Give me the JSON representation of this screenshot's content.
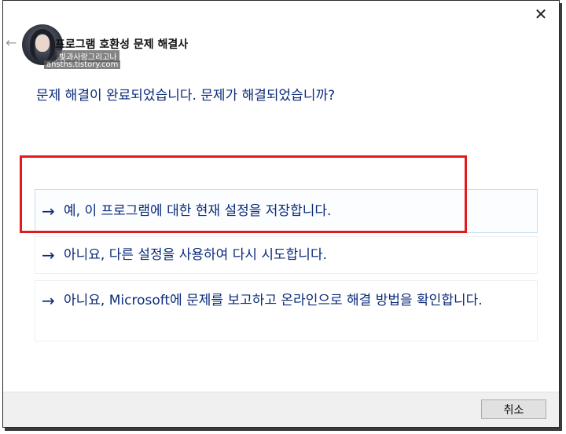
{
  "window": {
    "title": "프로그램 호환성 문제 해결사",
    "close_glyph": "✕",
    "back_glyph": "←"
  },
  "watermark": {
    "line1": "빛과사랑그리고나",
    "line2": "ansths.tistory.com"
  },
  "main": {
    "heading": "문제 해결이 완료되었습니다. 문제가 해결되었습니까?",
    "options": [
      {
        "arrow": "→",
        "label": "예, 이 프로그램에 대한 현재 설정을 저장합니다."
      },
      {
        "arrow": "→",
        "label": "아니요, 다른 설정을 사용하여 다시 시도합니다."
      },
      {
        "arrow": "→",
        "label": "아니요, Microsoft에 문제를 보고하고 온라인으로 해결 방법을 확인합니다."
      }
    ]
  },
  "footer": {
    "cancel_label": "취소"
  },
  "colors": {
    "link_text": "#0a2a7a",
    "highlight_border": "#e11b1b",
    "hover_border": "#c6daf2"
  }
}
